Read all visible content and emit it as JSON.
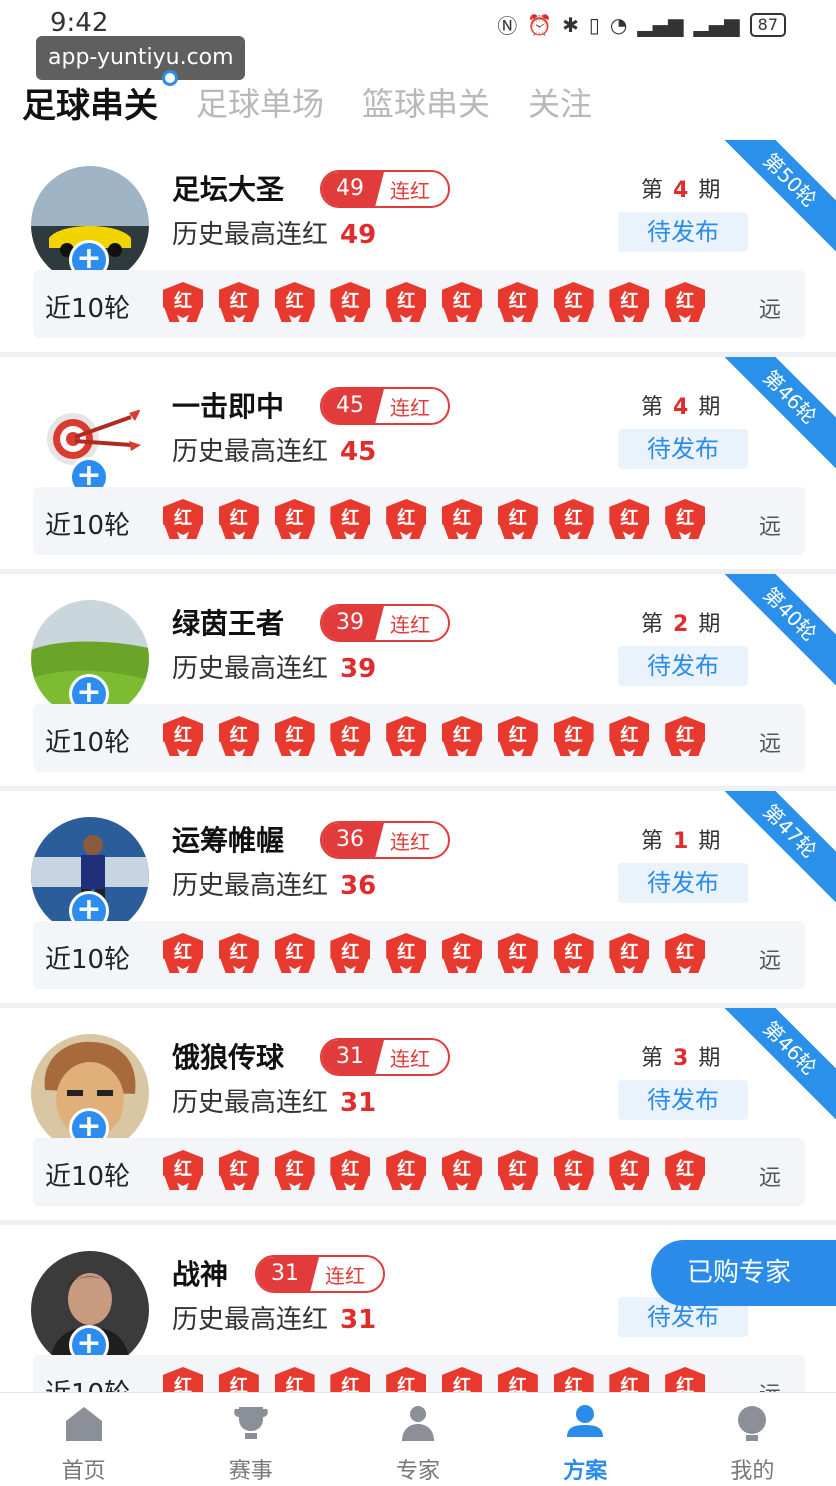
{
  "status_bar": {
    "time": "9:42",
    "battery": "87"
  },
  "watermark": "app-yuntiyu.com",
  "tabs": [
    {
      "label": "足球串关",
      "active": true
    },
    {
      "label": "足球单场",
      "active": false
    },
    {
      "label": "篮球串关",
      "active": false
    },
    {
      "label": "关注",
      "active": false
    }
  ],
  "common": {
    "streak_label": "连红",
    "history_label": "历史最高连红",
    "period_prefix": "第",
    "period_suffix": "期",
    "status_label": "待发布",
    "recent_label": "近10轮",
    "result_label": "红",
    "more_label": "远"
  },
  "experts": [
    {
      "name": "足坛大圣",
      "streak": "49",
      "history": "49",
      "period": "4",
      "ribbon": "第50轮",
      "avatar": "car"
    },
    {
      "name": "一击即中",
      "streak": "45",
      "history": "45",
      "period": "4",
      "ribbon": "第46轮",
      "avatar": "target"
    },
    {
      "name": "绿茵王者",
      "streak": "39",
      "history": "39",
      "period": "2",
      "ribbon": "第40轮",
      "avatar": "field"
    },
    {
      "name": "运筹帷幄",
      "streak": "36",
      "history": "36",
      "period": "1",
      "ribbon": "第47轮",
      "avatar": "player"
    },
    {
      "name": "饿狼传球",
      "streak": "31",
      "history": "31",
      "period": "3",
      "ribbon": "第46轮",
      "avatar": "cartoon"
    },
    {
      "name": "战神",
      "streak": "31",
      "history": "31",
      "period": "",
      "ribbon": "",
      "avatar": "man"
    }
  ],
  "float_button": "已购专家",
  "bottom_nav": [
    {
      "label": "首页",
      "icon": "home-icon",
      "active": false
    },
    {
      "label": "赛事",
      "icon": "trophy-icon",
      "active": false
    },
    {
      "label": "专家",
      "icon": "expert-icon",
      "active": false
    },
    {
      "label": "方案",
      "icon": "plan-icon",
      "active": true
    },
    {
      "label": "我的",
      "icon": "profile-icon",
      "active": false
    }
  ],
  "colors": {
    "accent": "#2a8ce8",
    "red": "#e23b3b"
  }
}
